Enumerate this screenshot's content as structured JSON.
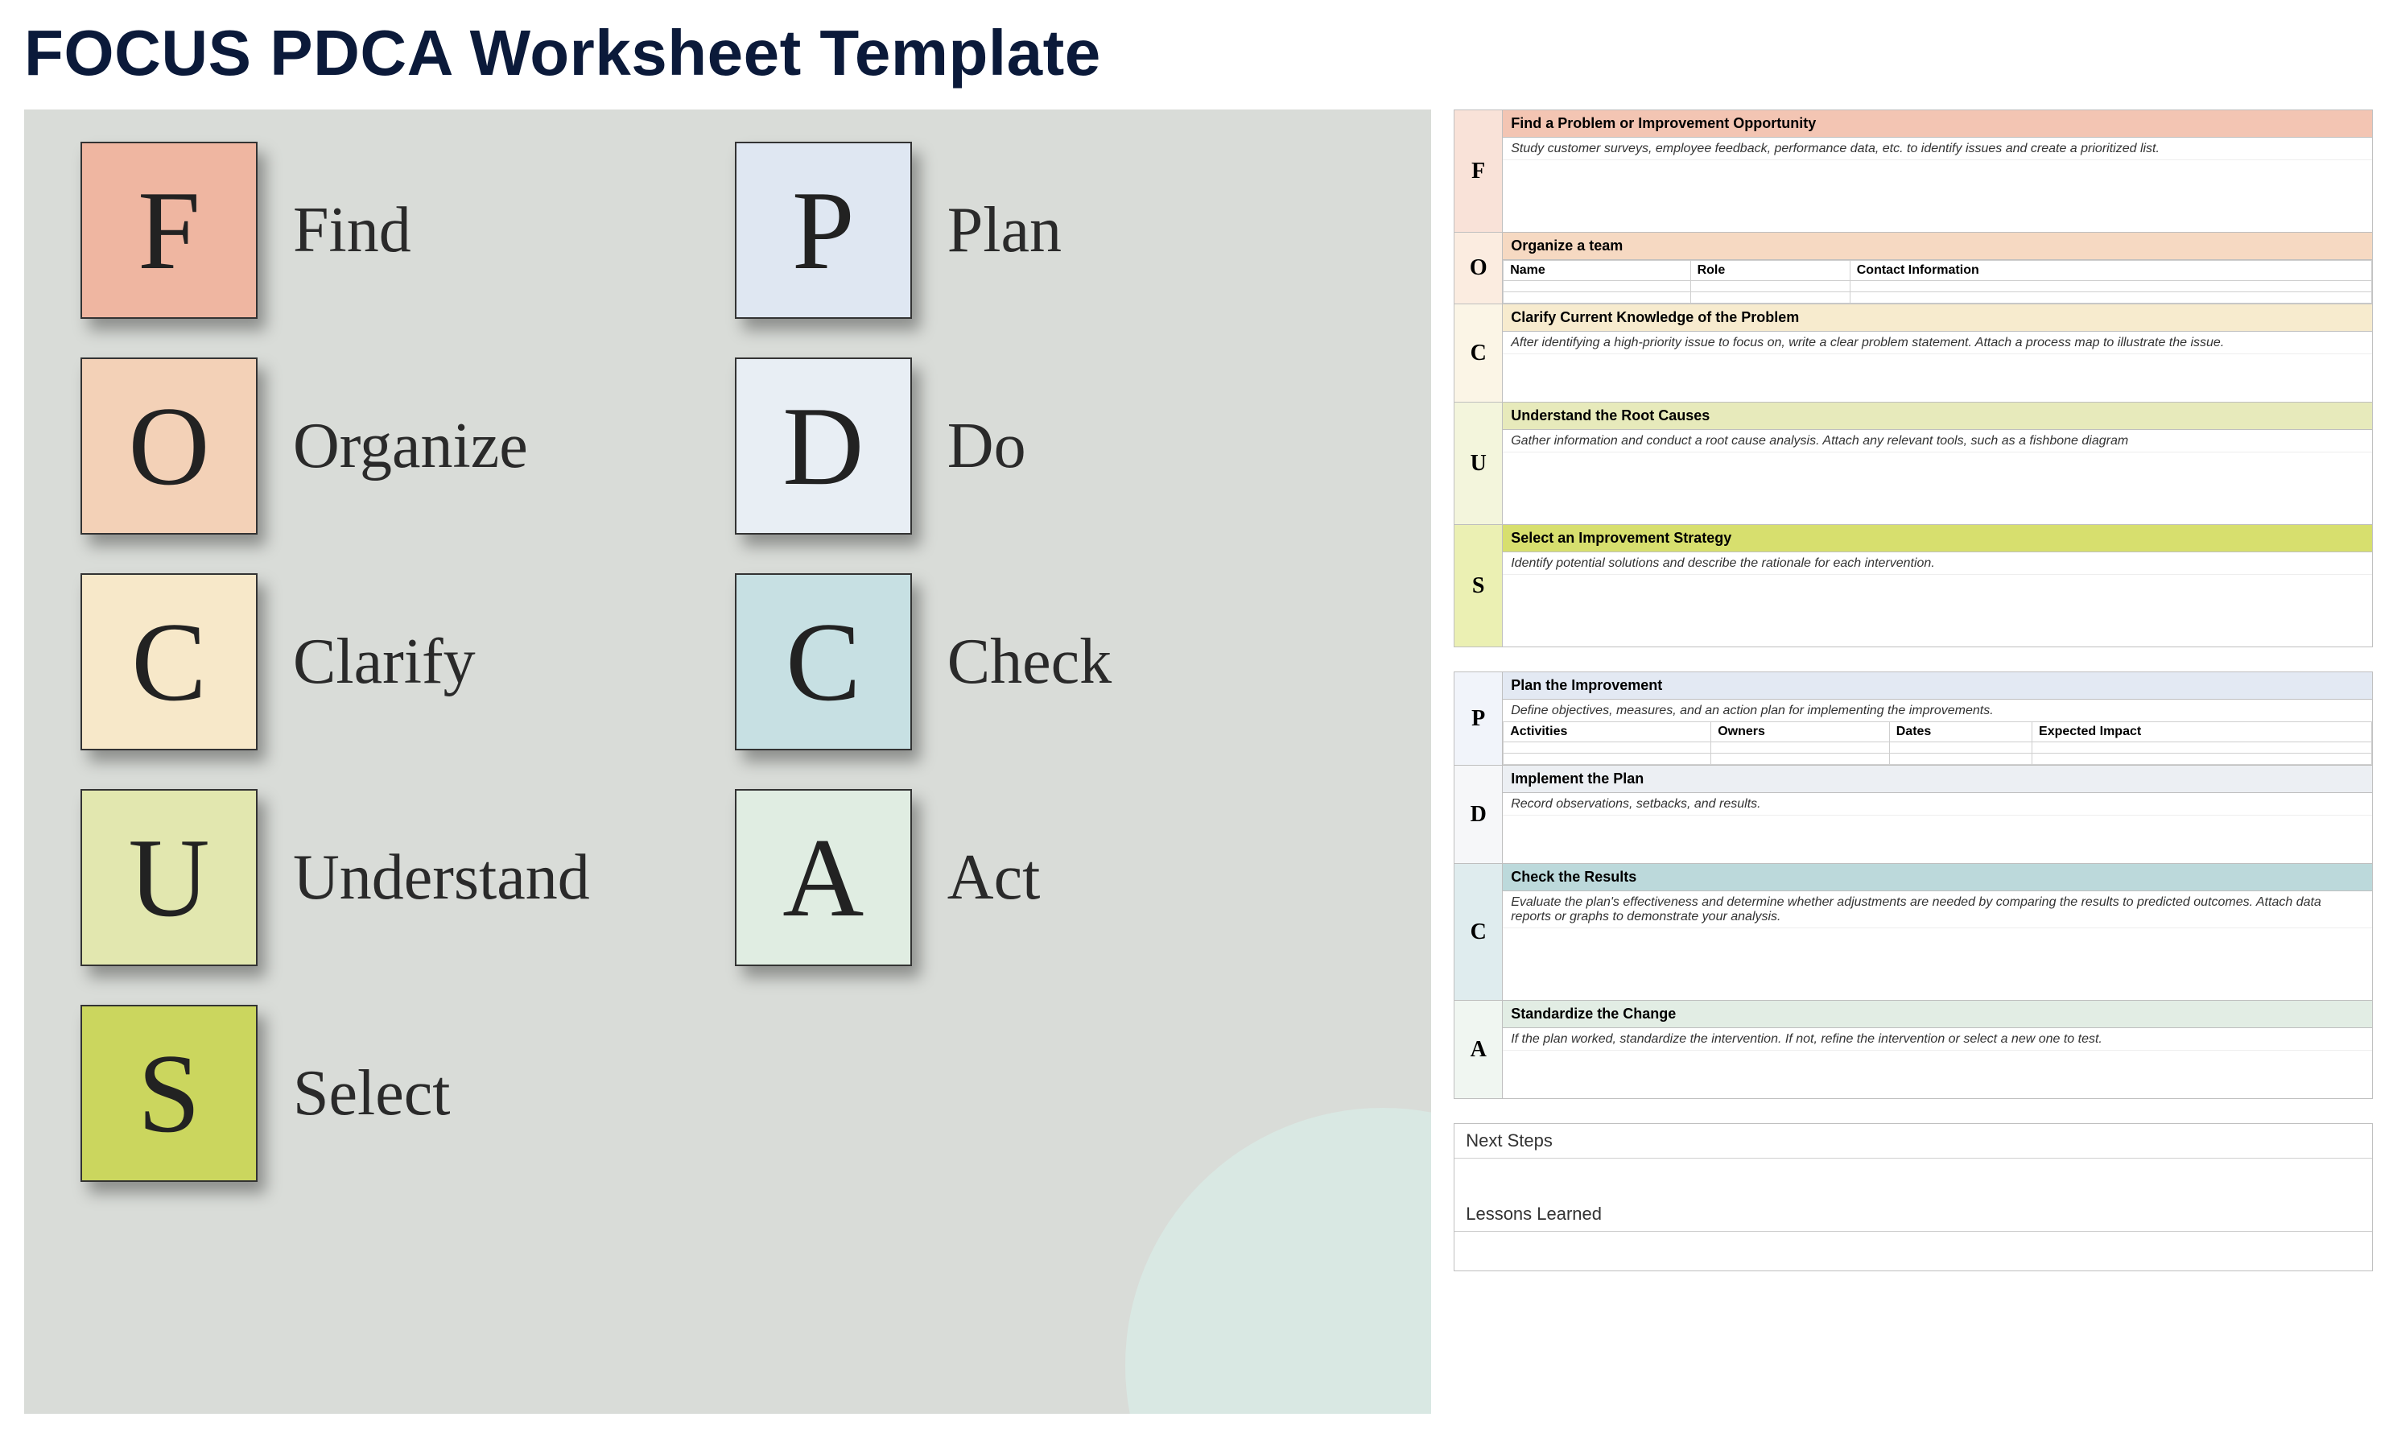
{
  "title": "FOCUS PDCA Worksheet Template",
  "diagram": {
    "focus": [
      {
        "letter": "F",
        "word": "Find",
        "tileClass": "c-f"
      },
      {
        "letter": "O",
        "word": "Organize",
        "tileClass": "c-o"
      },
      {
        "letter": "C",
        "word": "Clarify",
        "tileClass": "c-c"
      },
      {
        "letter": "U",
        "word": "Understand",
        "tileClass": "c-u"
      },
      {
        "letter": "S",
        "word": "Select",
        "tileClass": "c-s"
      }
    ],
    "pdca": [
      {
        "letter": "P",
        "word": "Plan",
        "tileClass": "c-p"
      },
      {
        "letter": "D",
        "word": "Do",
        "tileClass": "c-d"
      },
      {
        "letter": "C",
        "word": "Check",
        "tileClass": "c-c2"
      },
      {
        "letter": "A",
        "word": "Act",
        "tileClass": "c-a"
      }
    ]
  },
  "focus_sections": {
    "F": {
      "heading": "Find a Problem or Improvement Opportunity",
      "desc": "Study customer surveys, employee feedback, performance data, etc. to identify issues and create a prioritized list."
    },
    "O": {
      "heading": "Organize a team",
      "columns": [
        "Name",
        "Role",
        "Contact Information"
      ]
    },
    "C": {
      "heading": "Clarify Current Knowledge of the Problem",
      "desc": "After identifying a high-priority issue to focus on, write a clear problem statement. Attach a process map to illustrate the issue."
    },
    "U": {
      "heading": "Understand the Root Causes",
      "desc": "Gather information and conduct a root cause analysis. Attach any relevant tools, such as a fishbone diagram"
    },
    "S": {
      "heading": "Select an Improvement Strategy",
      "desc": "Identify potential solutions and describe the rationale for each intervention."
    }
  },
  "pdca_sections": {
    "P": {
      "heading": "Plan the Improvement",
      "desc": "Define objectives, measures, and an action plan for implementing the improvements.",
      "columns": [
        "Activities",
        "Owners",
        "Dates",
        "Expected Impact"
      ]
    },
    "D": {
      "heading": "Implement the Plan",
      "desc": "Record observations, setbacks, and results."
    },
    "C": {
      "heading": "Check the Results",
      "desc": "Evaluate the plan's effectiveness and determine whether adjustments are needed by comparing the results to predicted outcomes. Attach data reports or graphs to demonstrate your analysis."
    },
    "A": {
      "heading": "Standardize the Change",
      "desc": "If the plan worked, standardize the intervention. If not, refine the intervention or select a new one to test."
    }
  },
  "footer": {
    "next_steps": "Next Steps",
    "lessons": "Lessons Learned"
  }
}
